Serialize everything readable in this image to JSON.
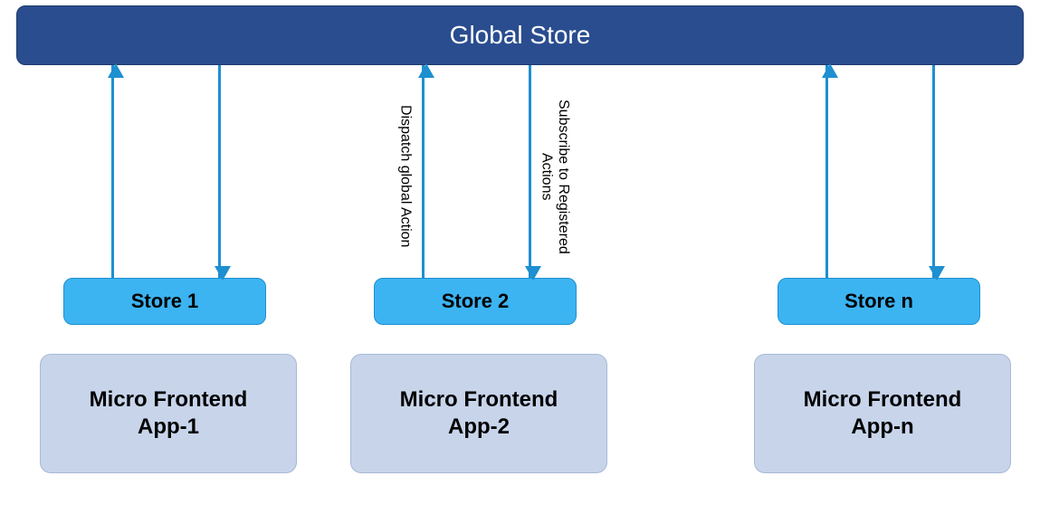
{
  "global_store": {
    "label": "Global Store"
  },
  "columns": [
    {
      "store_label": "Store 1",
      "app_label": "Micro Frontend\nApp-1"
    },
    {
      "store_label": "Store 2",
      "app_label": "Micro Frontend\nApp-2"
    },
    {
      "store_label": "Store n",
      "app_label": "Micro Frontend\nApp-n"
    }
  ],
  "arrow_labels": {
    "dispatch": "Dispatch global Action",
    "subscribe": "Subscribe to Registered\nActions"
  },
  "colors": {
    "global_bg": "#2a4d8f",
    "store_bg": "#3cb4f2",
    "app_bg": "#c7d4ea",
    "arrow": "#1e8fd1"
  }
}
